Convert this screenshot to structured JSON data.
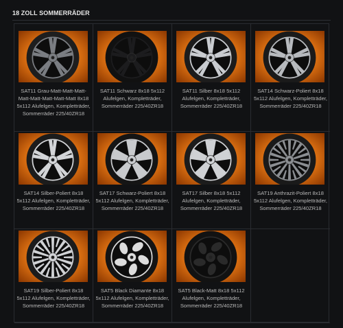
{
  "page": {
    "title": "18 ZOLL SOMMERRÄDER"
  },
  "products": [
    {
      "caption": "SAT11 Grau-Matt-Matt-Matt-Matt-Matt-Matt-Matt-Matt 8x18 5x112 Alufelgen, Kompletträder, Sommerräder 225/40ZR18",
      "rim": "#7a7d82",
      "tire": "#1e1e1e",
      "spokes": "double"
    },
    {
      "caption": "SAT11 Schwarz 8x18 5x112 Alufelgen, Kompletträder, Sommerräder 225/40ZR18",
      "rim": "#1c1c1e",
      "tire": "#111111",
      "spokes": "double"
    },
    {
      "caption": "SAT11 Silber 8x18 5x112 Alufelgen, Kompletträder, Sommerräder 225/40ZR18",
      "rim": "#c9ccd0",
      "tire": "#1c1c1c",
      "spokes": "double"
    },
    {
      "caption": "SAT14 Schwarz-Poliert 8x18 5x112 Alufelgen, Kompletträder, Sommerräder 225/40ZR18",
      "rim": "#b7babe",
      "tire": "#1a1a1a",
      "spokes": "double"
    },
    {
      "caption": "SAT14 Silber-Poliert 8x18 5x112 Alufelgen, Kompletträder, Sommerräder 225/40ZR18",
      "rim": "#d3d5d8",
      "tire": "#1c1c1c",
      "spokes": "double"
    },
    {
      "caption": "SAT17 Schwarz-Poliert 8x18 5x112 Alufelgen, Kompletträder, Sommerräder 225/40ZR18",
      "rim": "#c8cacd",
      "tire": "#151515",
      "spokes": "wide"
    },
    {
      "caption": "SAT17 Silber 8x18 5x112 Alufelgen, Kompletträder, Sommerräder 225/40ZR18",
      "rim": "#cfd1d4",
      "tire": "#1c1c1c",
      "spokes": "wide"
    },
    {
      "caption": "SAT19 Anthrazit-Poliert 8x18 5x112 Alufelgen, Kompletträder, Sommerräder 225/40ZR18",
      "rim": "#8b8e92",
      "tire": "#1a1a1a",
      "spokes": "mesh"
    },
    {
      "caption": "SAT19 Silber-Poliert 8x18 5x112 Alufelgen, Kompletträder, Sommerräder 225/40ZR18",
      "rim": "#d0d2d5",
      "tire": "#1c1c1c",
      "spokes": "mesh"
    },
    {
      "caption": "SAT5 Black Diamante 8x18 5x112 Alufelgen, Kompletträder, Sommerräder 225/40ZR18",
      "rim": "#dcdcdc",
      "tire": "#141414",
      "spokes": "turbine"
    },
    {
      "caption": "SAT5 Black-Matt 8x18 5x112 Alufelgen, Kompletträder, Sommerräder 225/40ZR18",
      "rim": "#2a2a2a",
      "tire": "#121212",
      "spokes": "turbine"
    }
  ]
}
